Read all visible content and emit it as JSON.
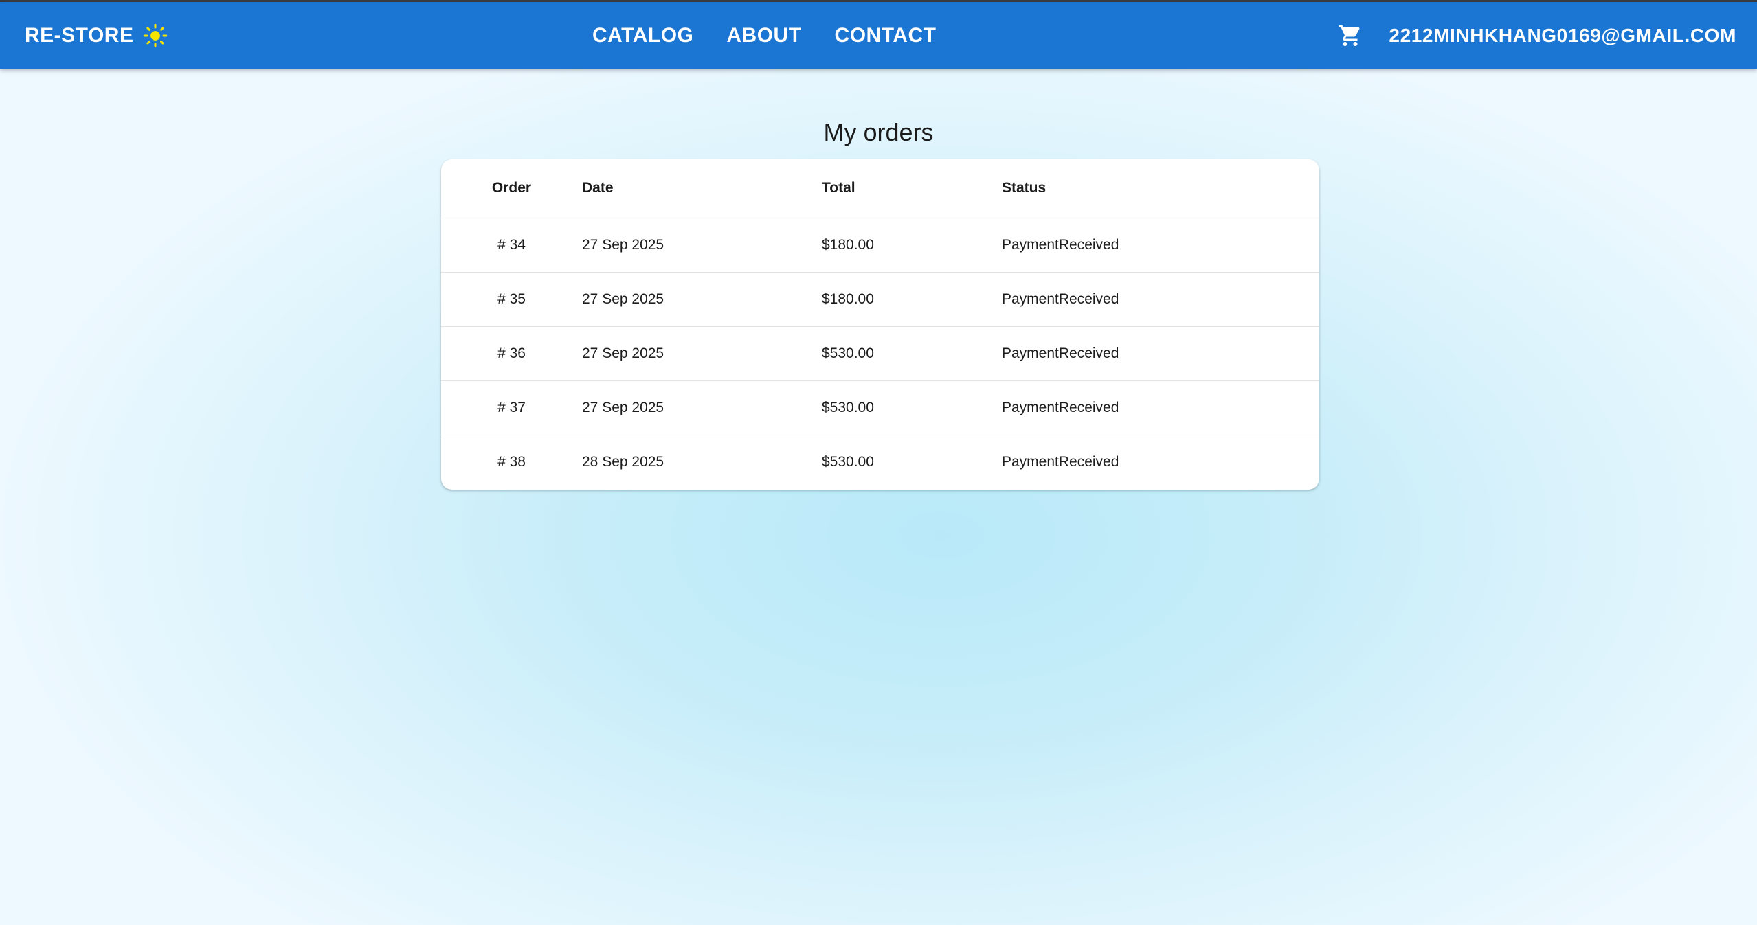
{
  "header": {
    "brand": "RE-STORE",
    "theme_icon": "sun-icon",
    "nav": [
      {
        "label": "CATALOG"
      },
      {
        "label": "ABOUT"
      },
      {
        "label": "CONTACT"
      }
    ],
    "cart_icon": "cart-icon",
    "user_email": "2212MINHKHANG0169@GMAIL.COM",
    "bar_color": "#1a76d2",
    "sun_color": "#f5e400"
  },
  "main": {
    "title": "My orders",
    "table": {
      "columns": [
        "Order",
        "Date",
        "Total",
        "Status"
      ],
      "rows": [
        {
          "order": "# 34",
          "date": "27 Sep 2025",
          "total": "$180.00",
          "status": "PaymentReceived"
        },
        {
          "order": "# 35",
          "date": "27 Sep 2025",
          "total": "$180.00",
          "status": "PaymentReceived"
        },
        {
          "order": "# 36",
          "date": "27 Sep 2025",
          "total": "$530.00",
          "status": "PaymentReceived"
        },
        {
          "order": "# 37",
          "date": "27 Sep 2025",
          "total": "$530.00",
          "status": "PaymentReceived"
        },
        {
          "order": "# 38",
          "date": "28 Sep 2025",
          "total": "$530.00",
          "status": "PaymentReceived"
        }
      ]
    }
  }
}
